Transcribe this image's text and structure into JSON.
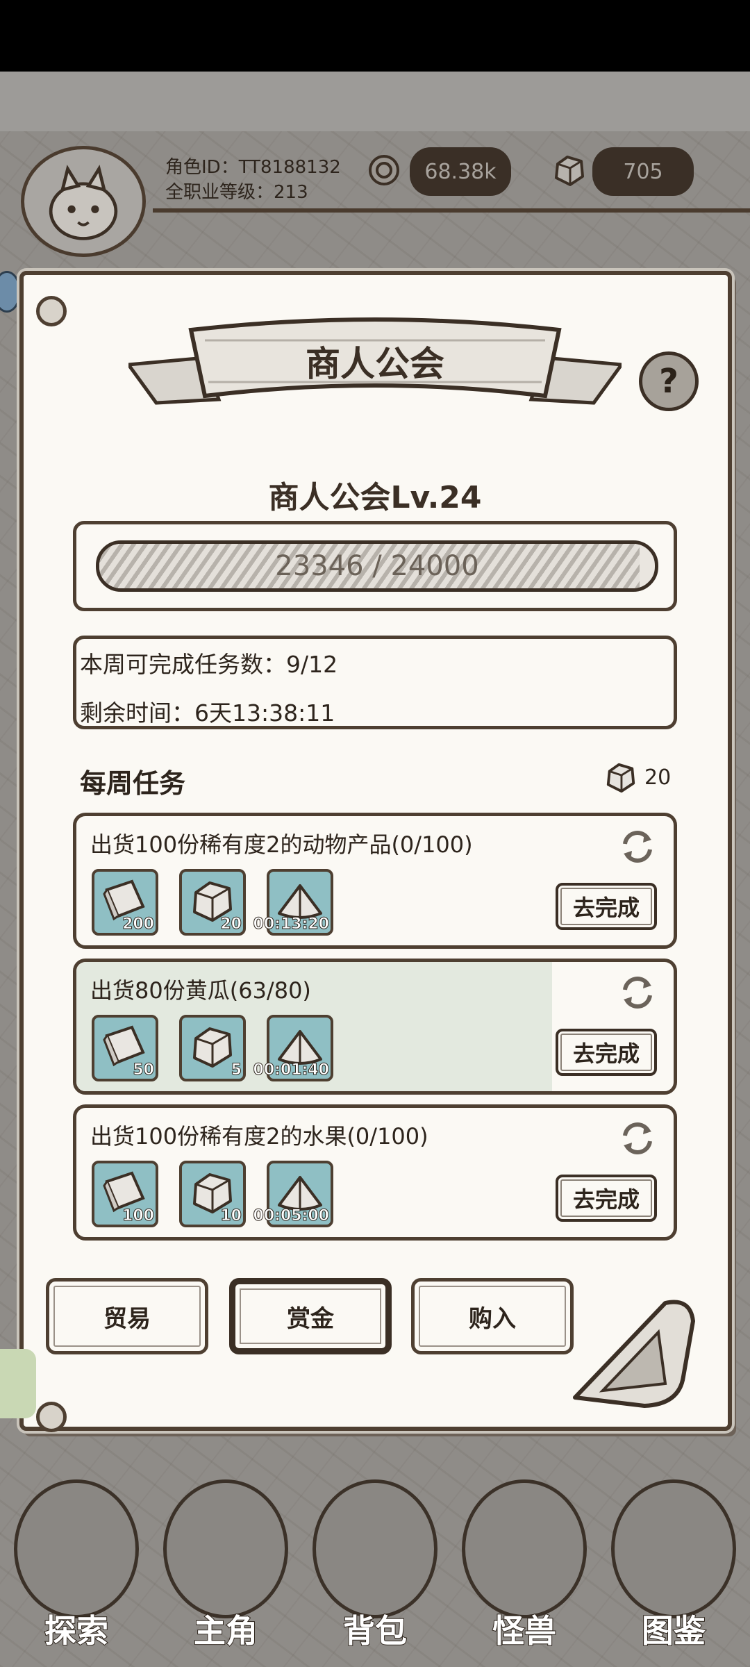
{
  "header": {
    "player_id": "角色ID：TT8188132",
    "player_level": "全职业等级：213",
    "coins": "68.38k",
    "gems": "705",
    "coin_icon": "coin-icon",
    "gem_icon": "gem-icon"
  },
  "panel": {
    "title": "商人公会",
    "help_label": "?",
    "guild_level": "商人公会Lv.24",
    "progress": {
      "current": 23346,
      "max": 24000,
      "text": "23346 / 24000"
    },
    "weekly_tasks_left": "本周可完成任务数：9/12",
    "time_left": "剩余时间：6天13:38:11",
    "weekly_title": "每周任务",
    "weekly_reward": "20"
  },
  "tasks": [
    {
      "title": "出货100份稀有度2的动物产品(0/100)",
      "rewards": [
        {
          "icon": "exp-book-icon",
          "count": "200"
        },
        {
          "icon": "gem-icon",
          "count": "20"
        },
        {
          "icon": "time-pile-icon",
          "count": "00:13:20"
        }
      ],
      "button": "去完成",
      "highlighted": false
    },
    {
      "title": "出货80份黄瓜(63/80)",
      "rewards": [
        {
          "icon": "exp-book-icon",
          "count": "50"
        },
        {
          "icon": "gem-icon",
          "count": "5"
        },
        {
          "icon": "time-pile-icon",
          "count": "00:01:40"
        }
      ],
      "button": "去完成",
      "highlighted": true
    },
    {
      "title": "出货100份稀有度2的水果(0/100)",
      "rewards": [
        {
          "icon": "exp-book-icon",
          "count": "100"
        },
        {
          "icon": "gem-icon",
          "count": "10"
        },
        {
          "icon": "time-pile-icon",
          "count": "00:05:00"
        }
      ],
      "button": "去完成",
      "highlighted": false
    }
  ],
  "tabs": [
    {
      "label": "贸易",
      "active": false
    },
    {
      "label": "赏金",
      "active": true
    },
    {
      "label": "购入",
      "active": false
    }
  ],
  "nav": [
    {
      "label": "探索",
      "icon": "ship-icon"
    },
    {
      "label": "主角",
      "icon": "hero-helmet-icon"
    },
    {
      "label": "背包",
      "icon": "backpack-icon"
    },
    {
      "label": "怪兽",
      "icon": "monster-eye-icon"
    },
    {
      "label": "图鉴",
      "icon": "book-icon"
    }
  ],
  "colors": {
    "ink": "#3b2f25",
    "paper": "#fbf9f4",
    "highlight_row": "#e3e9df",
    "reward_tile": "#8fbfc4"
  }
}
